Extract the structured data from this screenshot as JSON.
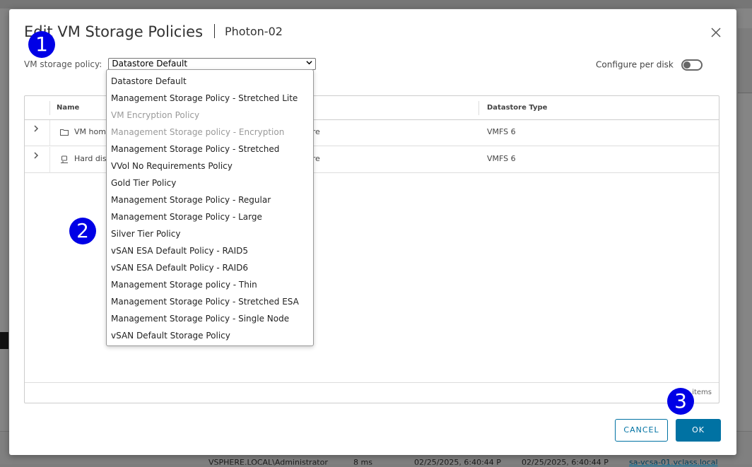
{
  "background": {
    "row_user": "VSPHERE.LOCAL\\Administrator",
    "row_ms": "8 ms",
    "row_start": "02/25/2025, 6:40:44 P",
    "row_end": "02/25/2025, 6:40:44 P",
    "row_server": "sa-vcsa-01.vclass.local"
  },
  "dialog": {
    "title": "Edit VM Storage Policies",
    "subtitle": "Photon-02",
    "close_icon": "close-icon"
  },
  "policy": {
    "label": "VM storage policy:",
    "selected": "Datastore Default"
  },
  "configure_per_disk": {
    "label": "Configure per disk",
    "enabled": false
  },
  "dropdown": {
    "options": [
      {
        "label": "Datastore Default",
        "disabled": false
      },
      {
        "label": "Management Storage Policy - Stretched Lite",
        "disabled": false
      },
      {
        "label": "VM Encryption Policy",
        "disabled": true
      },
      {
        "label": "Management Storage policy - Encryption",
        "disabled": true
      },
      {
        "label": "Management Storage Policy - Stretched",
        "disabled": false
      },
      {
        "label": "VVol No Requirements Policy",
        "disabled": false
      },
      {
        "label": "Gold Tier Policy",
        "disabled": false
      },
      {
        "label": "Management Storage Policy - Regular",
        "disabled": false
      },
      {
        "label": "Management Storage Policy - Large",
        "disabled": false
      },
      {
        "label": "Silver Tier Policy",
        "disabled": false
      },
      {
        "label": "vSAN ESA Default Policy - RAID5",
        "disabled": false
      },
      {
        "label": "vSAN ESA Default Policy - RAID6",
        "disabled": false
      },
      {
        "label": "Management Storage policy - Thin",
        "disabled": false
      },
      {
        "label": "Management Storage Policy - Stretched ESA",
        "disabled": false
      },
      {
        "label": "Management Storage Policy - Single Node",
        "disabled": false
      },
      {
        "label": "vSAN Default Storage Policy",
        "disabled": false
      }
    ]
  },
  "grid": {
    "columns": [
      "Name",
      "",
      "Datastore Type"
    ],
    "rows": [
      {
        "name": "VM hom",
        "datastore": "ore",
        "type": "VMFS 6",
        "icon": "folder-icon"
      },
      {
        "name": "Hard dis",
        "datastore": "ore",
        "type": "VMFS 6",
        "icon": "disk-icon"
      }
    ],
    "footer": "items"
  },
  "buttons": {
    "cancel": "CANCEL",
    "ok": "OK"
  },
  "markers": [
    "1",
    "2",
    "3"
  ]
}
